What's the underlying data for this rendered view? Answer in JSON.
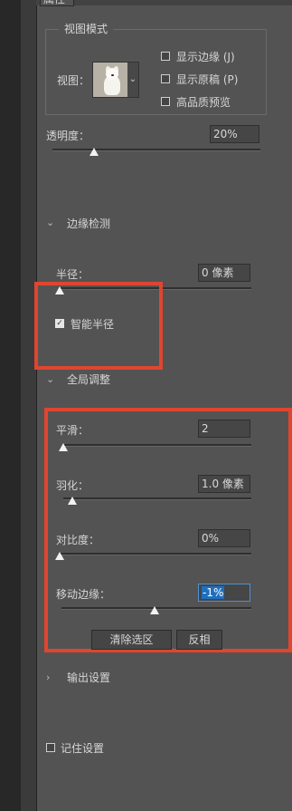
{
  "panel": {
    "tab_label": "属性"
  },
  "view_mode": {
    "legend": "视图模式",
    "view_label": "视图：",
    "options": [
      {
        "label": "显示边缘 (J)",
        "checked": false
      },
      {
        "label": "显示原稿 (P)",
        "checked": false
      },
      {
        "label": "高品质预览",
        "checked": false
      }
    ]
  },
  "opacity": {
    "label": "透明度：",
    "value": "20%",
    "slider_fraction": 0.2
  },
  "edge_detection": {
    "header": "边缘检测",
    "radius_label": "半径：",
    "radius_value": "0 像素",
    "radius_fraction": 0.0,
    "smart_radius_label": "智能半径",
    "smart_radius_checked": true
  },
  "global_refine": {
    "header": "全局调整",
    "smooth_label": "平滑：",
    "smooth_value": "2",
    "smooth_fraction": 0.0,
    "feather_label": "羽化：",
    "feather_value": "1.0 像素",
    "feather_fraction": 0.05,
    "contrast_label": "对比度：",
    "contrast_value": "0%",
    "contrast_fraction": 0.0,
    "shift_edge_label": "移动边缘：",
    "shift_edge_value": "-1%",
    "shift_edge_fraction": 0.49,
    "clear_selection_label": "清除选区",
    "invert_label": "反相"
  },
  "output_settings": {
    "header": "输出设置"
  },
  "remember_settings": {
    "label": "记住设置",
    "checked": false
  },
  "colors": {
    "panel_bg": "#535353",
    "highlight": "#e0452f",
    "selection_blue": "#1f6fbf"
  }
}
